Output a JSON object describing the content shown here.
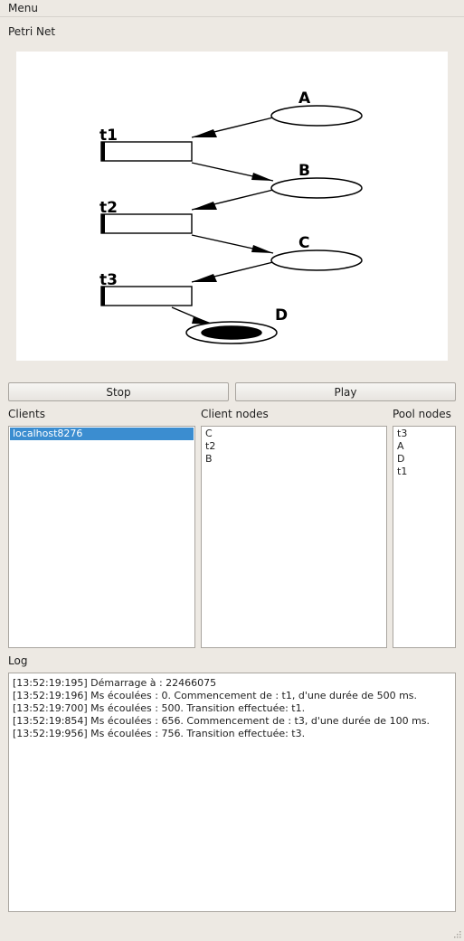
{
  "menubar": {
    "menu_label": "Menu"
  },
  "petri": {
    "section_label": "Petri Net",
    "places": [
      {
        "id": "A",
        "marked": false
      },
      {
        "id": "B",
        "marked": false
      },
      {
        "id": "C",
        "marked": false
      },
      {
        "id": "D",
        "marked": true
      }
    ],
    "transitions": [
      {
        "id": "t1"
      },
      {
        "id": "t2"
      },
      {
        "id": "t3"
      }
    ]
  },
  "controls": {
    "stop_label": "Stop",
    "play_label": "Play"
  },
  "clients": {
    "label": "Clients",
    "items": [
      "localhost8276"
    ],
    "selected": "localhost8276"
  },
  "client_nodes": {
    "label": "Client nodes",
    "items": [
      "C",
      "t2",
      "B"
    ]
  },
  "pool_nodes": {
    "label": "Pool nodes",
    "items": [
      "t3",
      "A",
      "D",
      "t1"
    ]
  },
  "log": {
    "label": "Log",
    "lines": [
      "[13:52:19:195] Démarrage à : 22466075",
      "[13:52:19:196] Ms écoulées : 0. Commencement de : t1, d'une durée de 500 ms.",
      "[13:52:19:700] Ms écoulées : 500. Transition effectuée: t1.",
      "[13:52:19:854] Ms écoulées : 656. Commencement de : t3, d'une durée de 100 ms.",
      "[13:52:19:956] Ms écoulées : 756. Transition effectuée: t3."
    ]
  }
}
